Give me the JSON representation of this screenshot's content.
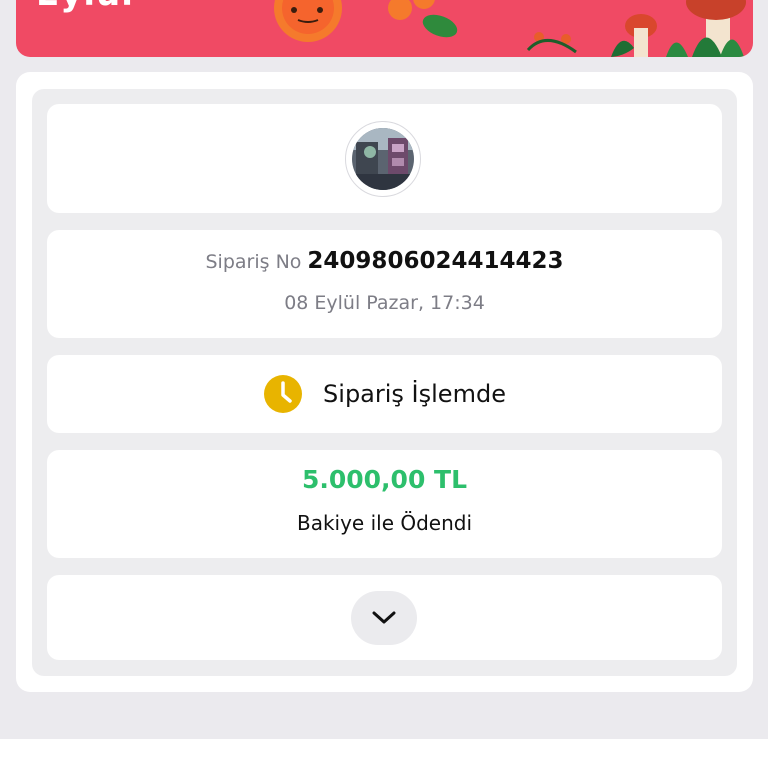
{
  "banner": {
    "title": "Eylül",
    "background_color": "#f04a64"
  },
  "order": {
    "label": "Sipariş No",
    "number": "2409806024414423",
    "date": "08 Eylül Pazar, 17:34"
  },
  "status": {
    "icon": "clock-icon",
    "icon_color": "#e8b400",
    "text": "Sipariş İşlemde"
  },
  "payment": {
    "amount": "5.000,00 TL",
    "amount_color": "#2dbf6c",
    "method": "Bakiye ile Ödendi"
  },
  "expand": {
    "icon": "chevron-down-icon"
  }
}
